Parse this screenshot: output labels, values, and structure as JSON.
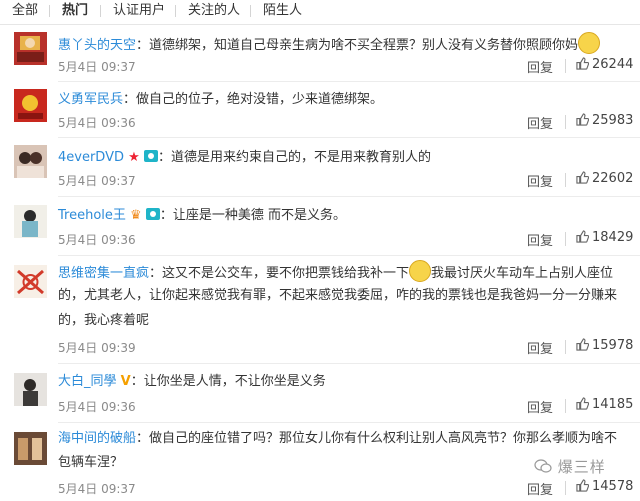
{
  "tabs": [
    "全部",
    "热门",
    "认证用户",
    "关注的人",
    "陌生人"
  ],
  "reply_label": "回复",
  "watermark": "爆三样",
  "comments": [
    {
      "user": "惠丫头的天空",
      "text": "：道德绑架，知道自己母亲生病为啥不买全程票？别人没有义务替你照顾你妈",
      "time": "5月4日 09:37",
      "likes": "26244"
    },
    {
      "user": "义勇军民兵",
      "text": "：做自己的位子，绝对没错，少来道德绑架。",
      "time": "5月4日 09:36",
      "likes": "25983"
    },
    {
      "user": "4everDVD",
      "text": "：道德是用来约束自己的，不是用来教育别人的",
      "time": "5月4日 09:37",
      "likes": "22602"
    },
    {
      "user": "Treehole王",
      "text": "：让座是一种美德 而不是义务。",
      "time": "5月4日 09:36",
      "likes": "18429"
    },
    {
      "user": "思维密集一直疯",
      "text_a": "：这又不是公交车，要不你把票钱给我补一下",
      "text_b": "我最讨厌火车动车上占别人座位",
      "line2": "的，尤其老人，让你起来感觉我有罪，不起来感觉我委屈，咋的我的票钱也是我爸妈一分一分赚来",
      "line3": "的，我心疼着呢",
      "time": "5月4日 09:39",
      "likes": "15978"
    },
    {
      "user": "大白_同學",
      "text": "：让你坐是人情，不让你坐是义务",
      "time": "5月4日 09:36",
      "likes": "14185"
    },
    {
      "user": "海中间的破船",
      "text": "：做自己的座位错了吗？那位女儿你有什么权利让别人高风亮节？你那么孝顺为啥不",
      "line2": "包辆车涅？",
      "time": "5月4日 09:37",
      "likes": "14578"
    }
  ]
}
